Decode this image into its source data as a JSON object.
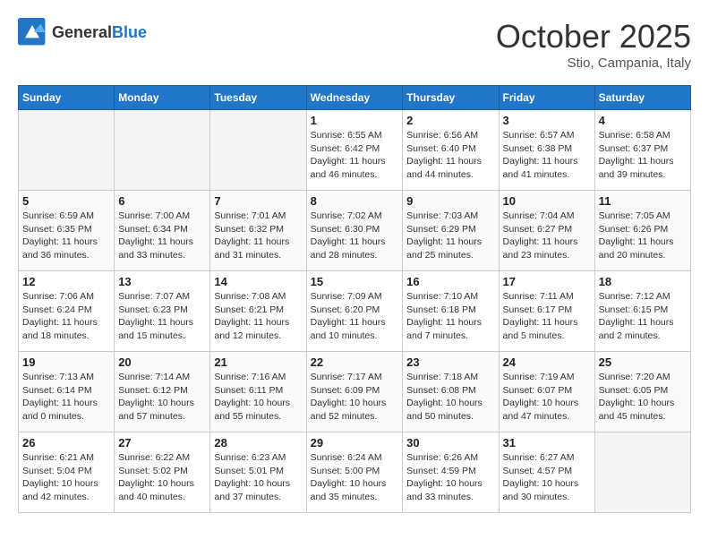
{
  "header": {
    "logo_general": "General",
    "logo_blue": "Blue",
    "month": "October 2025",
    "location": "Stio, Campania, Italy"
  },
  "days_of_week": [
    "Sunday",
    "Monday",
    "Tuesday",
    "Wednesday",
    "Thursday",
    "Friday",
    "Saturday"
  ],
  "weeks": [
    [
      {
        "day": "",
        "info": ""
      },
      {
        "day": "",
        "info": ""
      },
      {
        "day": "",
        "info": ""
      },
      {
        "day": "1",
        "info": "Sunrise: 6:55 AM\nSunset: 6:42 PM\nDaylight: 11 hours and 46 minutes."
      },
      {
        "day": "2",
        "info": "Sunrise: 6:56 AM\nSunset: 6:40 PM\nDaylight: 11 hours and 44 minutes."
      },
      {
        "day": "3",
        "info": "Sunrise: 6:57 AM\nSunset: 6:38 PM\nDaylight: 11 hours and 41 minutes."
      },
      {
        "day": "4",
        "info": "Sunrise: 6:58 AM\nSunset: 6:37 PM\nDaylight: 11 hours and 39 minutes."
      }
    ],
    [
      {
        "day": "5",
        "info": "Sunrise: 6:59 AM\nSunset: 6:35 PM\nDaylight: 11 hours and 36 minutes."
      },
      {
        "day": "6",
        "info": "Sunrise: 7:00 AM\nSunset: 6:34 PM\nDaylight: 11 hours and 33 minutes."
      },
      {
        "day": "7",
        "info": "Sunrise: 7:01 AM\nSunset: 6:32 PM\nDaylight: 11 hours and 31 minutes."
      },
      {
        "day": "8",
        "info": "Sunrise: 7:02 AM\nSunset: 6:30 PM\nDaylight: 11 hours and 28 minutes."
      },
      {
        "day": "9",
        "info": "Sunrise: 7:03 AM\nSunset: 6:29 PM\nDaylight: 11 hours and 25 minutes."
      },
      {
        "day": "10",
        "info": "Sunrise: 7:04 AM\nSunset: 6:27 PM\nDaylight: 11 hours and 23 minutes."
      },
      {
        "day": "11",
        "info": "Sunrise: 7:05 AM\nSunset: 6:26 PM\nDaylight: 11 hours and 20 minutes."
      }
    ],
    [
      {
        "day": "12",
        "info": "Sunrise: 7:06 AM\nSunset: 6:24 PM\nDaylight: 11 hours and 18 minutes."
      },
      {
        "day": "13",
        "info": "Sunrise: 7:07 AM\nSunset: 6:23 PM\nDaylight: 11 hours and 15 minutes."
      },
      {
        "day": "14",
        "info": "Sunrise: 7:08 AM\nSunset: 6:21 PM\nDaylight: 11 hours and 12 minutes."
      },
      {
        "day": "15",
        "info": "Sunrise: 7:09 AM\nSunset: 6:20 PM\nDaylight: 11 hours and 10 minutes."
      },
      {
        "day": "16",
        "info": "Sunrise: 7:10 AM\nSunset: 6:18 PM\nDaylight: 11 hours and 7 minutes."
      },
      {
        "day": "17",
        "info": "Sunrise: 7:11 AM\nSunset: 6:17 PM\nDaylight: 11 hours and 5 minutes."
      },
      {
        "day": "18",
        "info": "Sunrise: 7:12 AM\nSunset: 6:15 PM\nDaylight: 11 hours and 2 minutes."
      }
    ],
    [
      {
        "day": "19",
        "info": "Sunrise: 7:13 AM\nSunset: 6:14 PM\nDaylight: 11 hours and 0 minutes."
      },
      {
        "day": "20",
        "info": "Sunrise: 7:14 AM\nSunset: 6:12 PM\nDaylight: 10 hours and 57 minutes."
      },
      {
        "day": "21",
        "info": "Sunrise: 7:16 AM\nSunset: 6:11 PM\nDaylight: 10 hours and 55 minutes."
      },
      {
        "day": "22",
        "info": "Sunrise: 7:17 AM\nSunset: 6:09 PM\nDaylight: 10 hours and 52 minutes."
      },
      {
        "day": "23",
        "info": "Sunrise: 7:18 AM\nSunset: 6:08 PM\nDaylight: 10 hours and 50 minutes."
      },
      {
        "day": "24",
        "info": "Sunrise: 7:19 AM\nSunset: 6:07 PM\nDaylight: 10 hours and 47 minutes."
      },
      {
        "day": "25",
        "info": "Sunrise: 7:20 AM\nSunset: 6:05 PM\nDaylight: 10 hours and 45 minutes."
      }
    ],
    [
      {
        "day": "26",
        "info": "Sunrise: 6:21 AM\nSunset: 5:04 PM\nDaylight: 10 hours and 42 minutes."
      },
      {
        "day": "27",
        "info": "Sunrise: 6:22 AM\nSunset: 5:02 PM\nDaylight: 10 hours and 40 minutes."
      },
      {
        "day": "28",
        "info": "Sunrise: 6:23 AM\nSunset: 5:01 PM\nDaylight: 10 hours and 37 minutes."
      },
      {
        "day": "29",
        "info": "Sunrise: 6:24 AM\nSunset: 5:00 PM\nDaylight: 10 hours and 35 minutes."
      },
      {
        "day": "30",
        "info": "Sunrise: 6:26 AM\nSunset: 4:59 PM\nDaylight: 10 hours and 33 minutes."
      },
      {
        "day": "31",
        "info": "Sunrise: 6:27 AM\nSunset: 4:57 PM\nDaylight: 10 hours and 30 minutes."
      },
      {
        "day": "",
        "info": ""
      }
    ]
  ]
}
